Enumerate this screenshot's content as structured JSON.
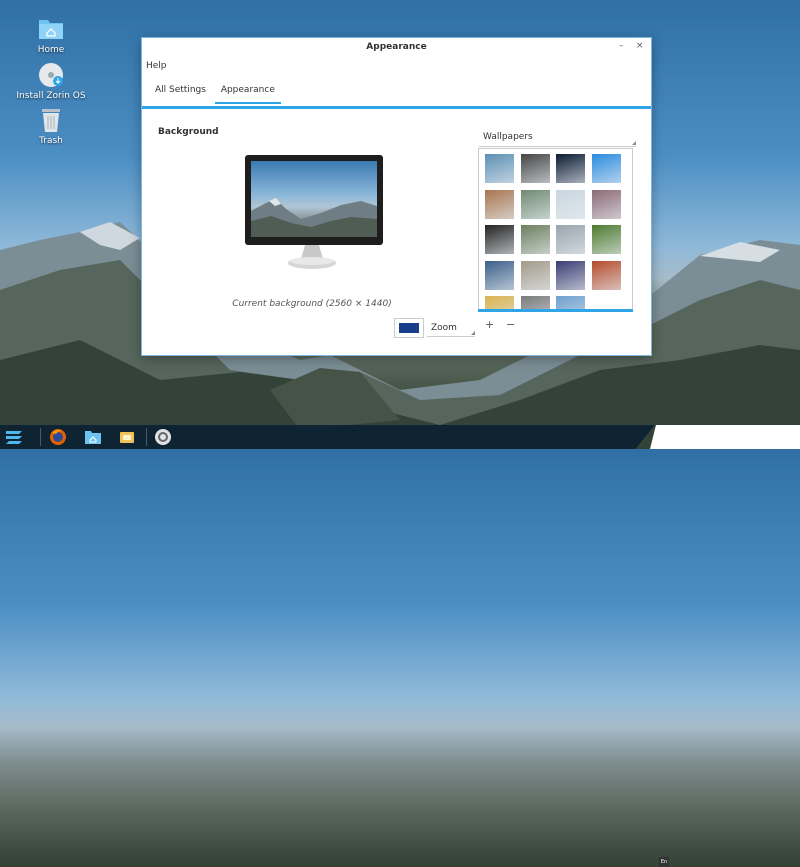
{
  "desktop": {
    "icons": [
      {
        "label": "Home",
        "icon": "home-folder-icon"
      },
      {
        "label": "Install Zorin OS",
        "icon": "install-disc-icon"
      },
      {
        "label": "Trash",
        "icon": "trash-icon"
      }
    ]
  },
  "window": {
    "title": "Appearance",
    "minimize_label": "–",
    "close_label": "×",
    "menu": {
      "help_label": "Help"
    },
    "tabs": [
      {
        "label": "All Settings",
        "active": false
      },
      {
        "label": "Appearance",
        "active": true
      }
    ],
    "background": {
      "heading": "Background",
      "caption": "Current background (2560 × 1440)",
      "color_button_color": "#1a3f8a",
      "mode_value": "Zoom"
    },
    "wallpapers": {
      "select_value": "Wallpapers",
      "add_label": "+",
      "remove_label": "−",
      "thumbnails": [
        "#5d8fb3",
        "#444",
        "#0b1a33",
        "#2a8be0",
        "#a87550",
        "#6f8a73",
        "#c9d6df",
        "#8c6a76",
        "#222",
        "#6d8060",
        "#9aa4ad",
        "#4d7a2e",
        "#3b5f88",
        "#a29a8a",
        "#3b3c72",
        "#b54c2c",
        "#d8b350",
        "#7a7a7a",
        "#6fa0cf"
      ]
    }
  },
  "taskbar": {
    "items": [
      "zorin-menu-icon",
      "firefox-icon",
      "files-icon",
      "software-icon",
      "settings-icon"
    ],
    "lang_label": "En"
  },
  "colors": {
    "accent": "#2fa4e7"
  }
}
